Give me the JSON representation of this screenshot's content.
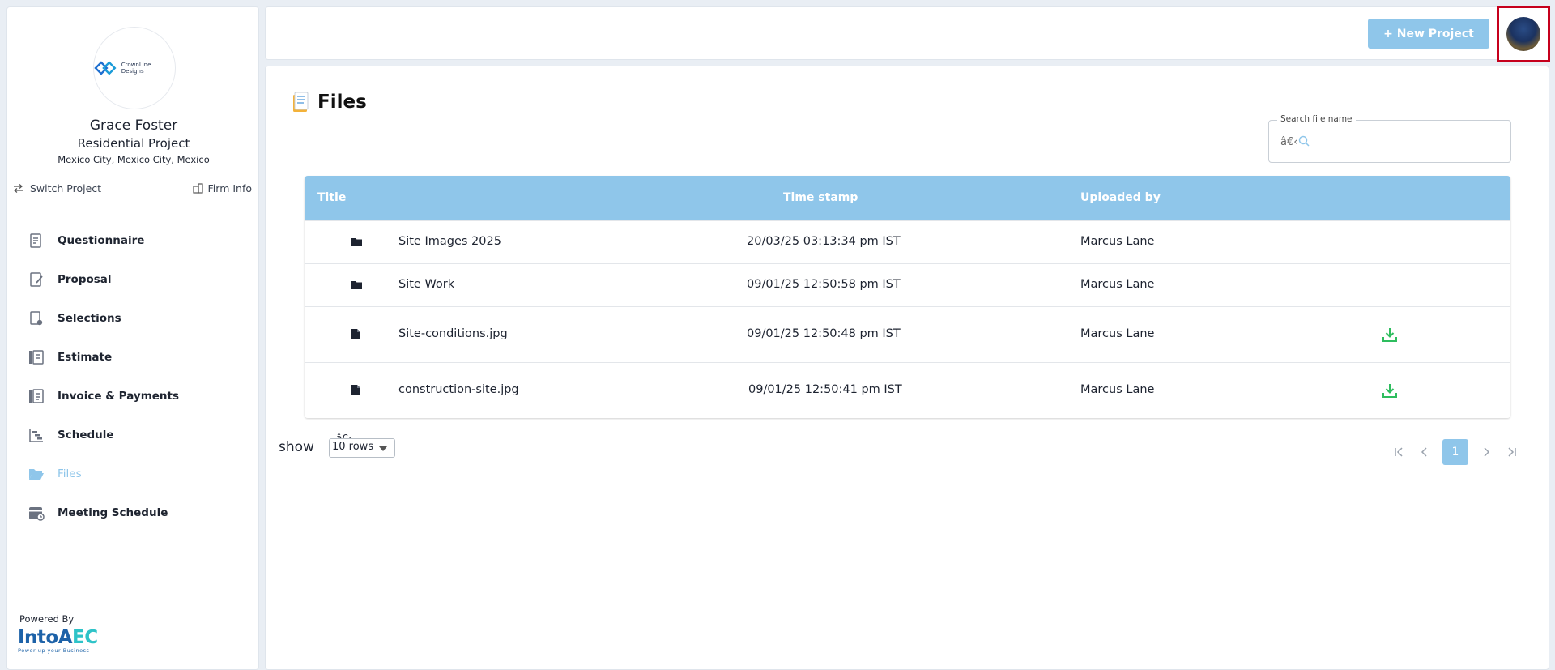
{
  "brand": {
    "logo_text": "CrownLine Designs"
  },
  "project": {
    "client_name": "Grace Foster",
    "project_name": "Residential Project",
    "location": "Mexico City, Mexico City, Mexico",
    "switch_label": "Switch Project",
    "firm_label": "Firm Info"
  },
  "nav": {
    "items": [
      {
        "label": "Questionnaire",
        "icon": "questionnaire-icon"
      },
      {
        "label": "Proposal",
        "icon": "proposal-icon"
      },
      {
        "label": "Selections",
        "icon": "selections-icon"
      },
      {
        "label": "Estimate",
        "icon": "estimate-icon"
      },
      {
        "label": "Invoice & Payments",
        "icon": "invoice-icon"
      },
      {
        "label": "Schedule",
        "icon": "schedule-icon"
      },
      {
        "label": "Files",
        "icon": "folder-open-icon",
        "active": true
      },
      {
        "label": "Meeting Schedule",
        "icon": "calendar-icon"
      }
    ]
  },
  "footer": {
    "powered_by": "Powered By",
    "logo_main": "IntoA",
    "logo_accent": "EC",
    "logo_tagline": "Power up your Business"
  },
  "topbar": {
    "new_project_label": "+ New Project"
  },
  "files": {
    "title": "Files",
    "search_label": "Search file name",
    "search_value": "â€‹",
    "columns": {
      "title": "Title",
      "timestamp": "Time stamp",
      "uploaded_by": "Uploaded by"
    },
    "rows": [
      {
        "type": "folder",
        "title": "Site Images 2025",
        "timestamp": "20/03/25 03:13:34 pm IST",
        "uploaded_by": "Marcus Lane",
        "downloadable": false
      },
      {
        "type": "folder",
        "title": "Site Work",
        "timestamp": "09/01/25 12:50:58 pm IST",
        "uploaded_by": "Marcus Lane",
        "downloadable": false
      },
      {
        "type": "file",
        "title": "Site-conditions.jpg",
        "timestamp": "09/01/25 12:50:48 pm IST",
        "uploaded_by": "Marcus Lane",
        "downloadable": true
      },
      {
        "type": "file",
        "title": "construction-site.jpg",
        "timestamp": "09/01/25 12:50:41 pm IST",
        "uploaded_by": "Marcus Lane",
        "downloadable": true
      }
    ],
    "show_label": "show",
    "rows_select_top": "â€‹",
    "rows_select_value": "10 rows",
    "current_page": "1"
  },
  "colors": {
    "accent": "#8fc6ea",
    "download": "#2ebd5e",
    "avatar_border": "#c6001c"
  }
}
